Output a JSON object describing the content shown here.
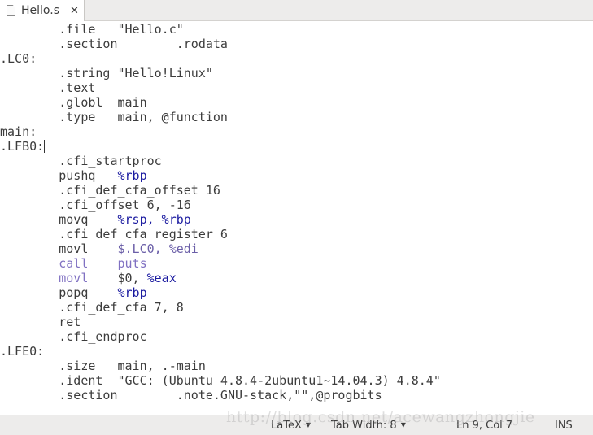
{
  "tab": {
    "title": "Hello.s",
    "close_icon": "close-icon",
    "file_icon": "document-icon"
  },
  "colors": {
    "text": "#3c3c3c",
    "register": "#1a1aa0",
    "operand": "#6b5fa8",
    "keyword": "#8071c2"
  },
  "cursor": {
    "line": 9,
    "col": 7
  },
  "lines": [
    [
      {
        "t": "        .file   \"Hello.c\"",
        "c": ""
      }
    ],
    [
      {
        "t": "        .section        .rodata",
        "c": ""
      }
    ],
    [
      {
        "t": ".LC0:",
        "c": ""
      }
    ],
    [
      {
        "t": "        .string \"Hello!Linux\"",
        "c": ""
      }
    ],
    [
      {
        "t": "        .text",
        "c": ""
      }
    ],
    [
      {
        "t": "        .globl  main",
        "c": ""
      }
    ],
    [
      {
        "t": "        .type   main, @function",
        "c": ""
      }
    ],
    [
      {
        "t": "main:",
        "c": ""
      }
    ],
    [
      {
        "t": ".LFB0:",
        "c": ""
      }
    ],
    [
      {
        "t": "        .cfi_startproc",
        "c": ""
      }
    ],
    [
      {
        "t": "        pushq   ",
        "c": ""
      },
      {
        "t": "%rbp",
        "c": "b"
      }
    ],
    [
      {
        "t": "        .cfi_def_cfa_offset 16",
        "c": ""
      }
    ],
    [
      {
        "t": "        .cfi_offset 6, -16",
        "c": ""
      }
    ],
    [
      {
        "t": "        movq    ",
        "c": ""
      },
      {
        "t": "%rsp, %rbp",
        "c": "b"
      }
    ],
    [
      {
        "t": "        .cfi_def_cfa_register 6",
        "c": ""
      }
    ],
    [
      {
        "t": "        movl    ",
        "c": ""
      },
      {
        "t": "$.LC0, %edi",
        "c": "p"
      }
    ],
    [
      {
        "t": "        ",
        "c": ""
      },
      {
        "t": "call    puts",
        "c": "l"
      }
    ],
    [
      {
        "t": "        ",
        "c": ""
      },
      {
        "t": "movl",
        "c": "l"
      },
      {
        "t": "    $0, ",
        "c": ""
      },
      {
        "t": "%eax",
        "c": "b"
      }
    ],
    [
      {
        "t": "        popq    ",
        "c": ""
      },
      {
        "t": "%rbp",
        "c": "b"
      }
    ],
    [
      {
        "t": "        .cfi_def_cfa 7, 8",
        "c": ""
      }
    ],
    [
      {
        "t": "        ret",
        "c": ""
      }
    ],
    [
      {
        "t": "        .cfi_endproc",
        "c": ""
      }
    ],
    [
      {
        "t": ".LFE0:",
        "c": ""
      }
    ],
    [
      {
        "t": "        .size   main, .-main",
        "c": ""
      }
    ],
    [
      {
        "t": "        .ident  \"GCC: (Ubuntu 4.8.4-2ubuntu1~14.04.3) 4.8.4\"",
        "c": ""
      }
    ],
    [
      {
        "t": "        .section        .note.GNU-stack,\"\",@progbits",
        "c": ""
      }
    ]
  ],
  "status": {
    "language": "LaTeX",
    "tab_width": "Tab Width: 8",
    "position": "Ln 9, Col 7",
    "mode": "INS"
  },
  "watermark": "http://blog.csdn.net/acewangzhongjie"
}
